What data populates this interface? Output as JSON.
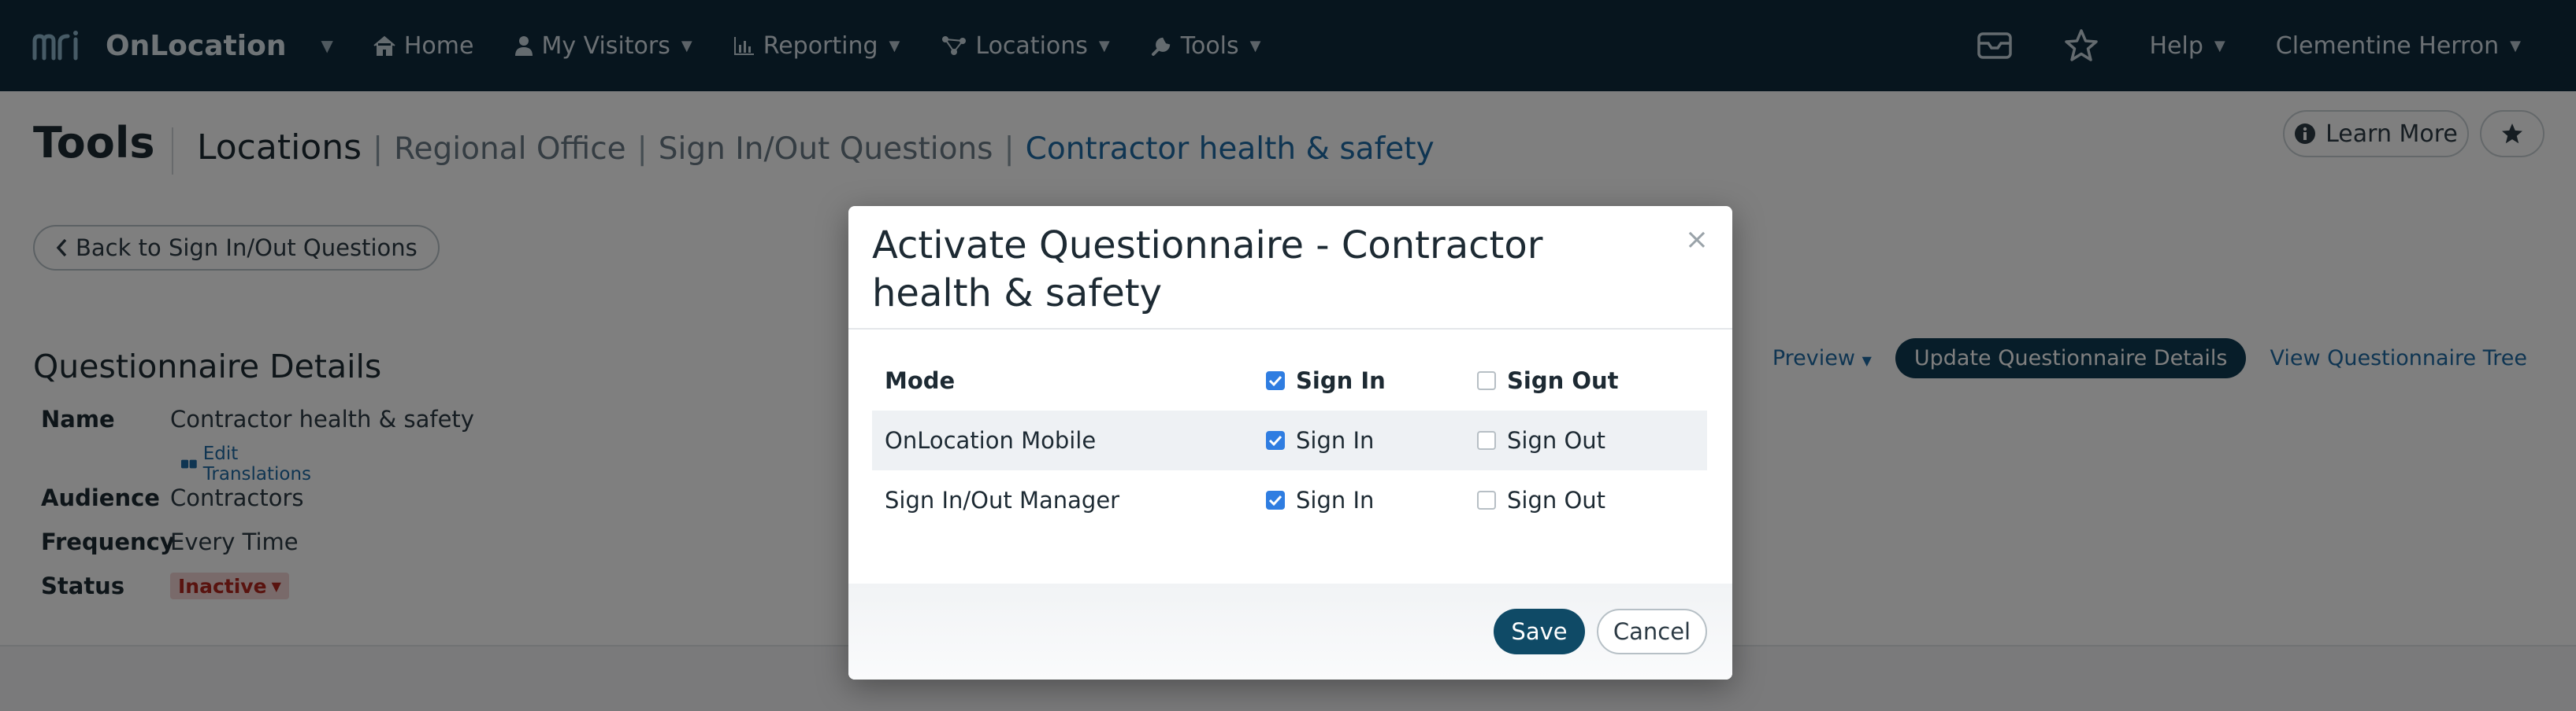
{
  "navbar": {
    "brand_name": "OnLocation",
    "items": [
      {
        "label": "Home",
        "icon": "home-icon"
      },
      {
        "label": "My Visitors",
        "icon": "user-icon"
      },
      {
        "label": "Reporting",
        "icon": "bar-chart-icon"
      },
      {
        "label": "Locations",
        "icon": "network-icon"
      },
      {
        "label": "Tools",
        "icon": "wrench-icon"
      }
    ],
    "help_label": "Help",
    "user_name": "Clementine Herron"
  },
  "header": {
    "title": "Tools",
    "breadcrumb": [
      "Locations",
      "Regional Office",
      "Sign In/Out Questions",
      "Contractor health & safety"
    ],
    "learn_more_label": "Learn More"
  },
  "back_button_label": "Back to Sign In/Out Questions",
  "details": {
    "section_title": "Questionnaire Details",
    "name_label": "Name",
    "name_value": "Contractor health & safety",
    "edit_translations_label": "Edit Translations",
    "audience_label": "Audience",
    "audience_value": "Contractors",
    "frequency_label": "Frequency",
    "frequency_value": "Every Time",
    "status_label": "Status",
    "status_value": "Inactive"
  },
  "actions": {
    "preview_label": "Preview",
    "update_label": "Update Questionnaire Details",
    "view_tree_label": "View Questionnaire Tree"
  },
  "modal": {
    "title": "Activate Questionnaire - Contractor health & safety",
    "close_symbol": "×",
    "header_row": {
      "mode": "Mode",
      "sign_in": "Sign In",
      "sign_out": "Sign Out",
      "sign_in_checked": true,
      "sign_out_checked": false
    },
    "rows": [
      {
        "mode": "OnLocation Mobile",
        "sign_in": "Sign In",
        "sign_out": "Sign Out",
        "sign_in_checked": true,
        "sign_out_checked": false
      },
      {
        "mode": "Sign In/Out Manager",
        "sign_in": "Sign In",
        "sign_out": "Sign Out",
        "sign_in_checked": true,
        "sign_out_checked": false
      }
    ],
    "save_label": "Save",
    "cancel_label": "Cancel"
  },
  "colors": {
    "navbar_bg": "#0f2b3d",
    "primary": "#0f4a66",
    "link": "#1f6aa5",
    "checkbox_on": "#2f7de1",
    "status_inactive": "#b3261e"
  }
}
